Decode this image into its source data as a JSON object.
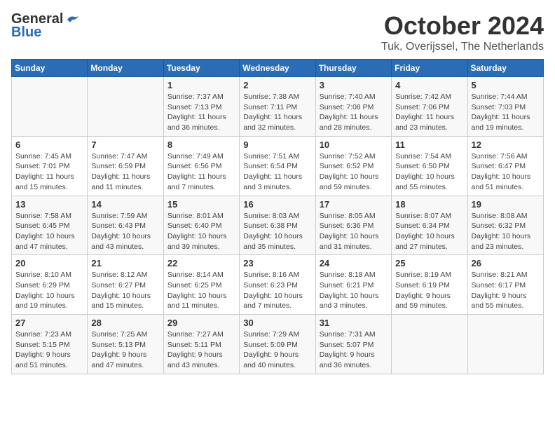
{
  "header": {
    "logo_general": "General",
    "logo_blue": "Blue",
    "month_title": "October 2024",
    "location": "Tuk, Overijssel, The Netherlands"
  },
  "calendar": {
    "headers": [
      "Sunday",
      "Monday",
      "Tuesday",
      "Wednesday",
      "Thursday",
      "Friday",
      "Saturday"
    ],
    "weeks": [
      [
        {
          "day": "",
          "info": ""
        },
        {
          "day": "",
          "info": ""
        },
        {
          "day": "1",
          "info": "Sunrise: 7:37 AM\nSunset: 7:13 PM\nDaylight: 11 hours and 36 minutes."
        },
        {
          "day": "2",
          "info": "Sunrise: 7:38 AM\nSunset: 7:11 PM\nDaylight: 11 hours and 32 minutes."
        },
        {
          "day": "3",
          "info": "Sunrise: 7:40 AM\nSunset: 7:08 PM\nDaylight: 11 hours and 28 minutes."
        },
        {
          "day": "4",
          "info": "Sunrise: 7:42 AM\nSunset: 7:06 PM\nDaylight: 11 hours and 23 minutes."
        },
        {
          "day": "5",
          "info": "Sunrise: 7:44 AM\nSunset: 7:03 PM\nDaylight: 11 hours and 19 minutes."
        }
      ],
      [
        {
          "day": "6",
          "info": "Sunrise: 7:45 AM\nSunset: 7:01 PM\nDaylight: 11 hours and 15 minutes."
        },
        {
          "day": "7",
          "info": "Sunrise: 7:47 AM\nSunset: 6:59 PM\nDaylight: 11 hours and 11 minutes."
        },
        {
          "day": "8",
          "info": "Sunrise: 7:49 AM\nSunset: 6:56 PM\nDaylight: 11 hours and 7 minutes."
        },
        {
          "day": "9",
          "info": "Sunrise: 7:51 AM\nSunset: 6:54 PM\nDaylight: 11 hours and 3 minutes."
        },
        {
          "day": "10",
          "info": "Sunrise: 7:52 AM\nSunset: 6:52 PM\nDaylight: 10 hours and 59 minutes."
        },
        {
          "day": "11",
          "info": "Sunrise: 7:54 AM\nSunset: 6:50 PM\nDaylight: 10 hours and 55 minutes."
        },
        {
          "day": "12",
          "info": "Sunrise: 7:56 AM\nSunset: 6:47 PM\nDaylight: 10 hours and 51 minutes."
        }
      ],
      [
        {
          "day": "13",
          "info": "Sunrise: 7:58 AM\nSunset: 6:45 PM\nDaylight: 10 hours and 47 minutes."
        },
        {
          "day": "14",
          "info": "Sunrise: 7:59 AM\nSunset: 6:43 PM\nDaylight: 10 hours and 43 minutes."
        },
        {
          "day": "15",
          "info": "Sunrise: 8:01 AM\nSunset: 6:40 PM\nDaylight: 10 hours and 39 minutes."
        },
        {
          "day": "16",
          "info": "Sunrise: 8:03 AM\nSunset: 6:38 PM\nDaylight: 10 hours and 35 minutes."
        },
        {
          "day": "17",
          "info": "Sunrise: 8:05 AM\nSunset: 6:36 PM\nDaylight: 10 hours and 31 minutes."
        },
        {
          "day": "18",
          "info": "Sunrise: 8:07 AM\nSunset: 6:34 PM\nDaylight: 10 hours and 27 minutes."
        },
        {
          "day": "19",
          "info": "Sunrise: 8:08 AM\nSunset: 6:32 PM\nDaylight: 10 hours and 23 minutes."
        }
      ],
      [
        {
          "day": "20",
          "info": "Sunrise: 8:10 AM\nSunset: 6:29 PM\nDaylight: 10 hours and 19 minutes."
        },
        {
          "day": "21",
          "info": "Sunrise: 8:12 AM\nSunset: 6:27 PM\nDaylight: 10 hours and 15 minutes."
        },
        {
          "day": "22",
          "info": "Sunrise: 8:14 AM\nSunset: 6:25 PM\nDaylight: 10 hours and 11 minutes."
        },
        {
          "day": "23",
          "info": "Sunrise: 8:16 AM\nSunset: 6:23 PM\nDaylight: 10 hours and 7 minutes."
        },
        {
          "day": "24",
          "info": "Sunrise: 8:18 AM\nSunset: 6:21 PM\nDaylight: 10 hours and 3 minutes."
        },
        {
          "day": "25",
          "info": "Sunrise: 8:19 AM\nSunset: 6:19 PM\nDaylight: 9 hours and 59 minutes."
        },
        {
          "day": "26",
          "info": "Sunrise: 8:21 AM\nSunset: 6:17 PM\nDaylight: 9 hours and 55 minutes."
        }
      ],
      [
        {
          "day": "27",
          "info": "Sunrise: 7:23 AM\nSunset: 5:15 PM\nDaylight: 9 hours and 51 minutes."
        },
        {
          "day": "28",
          "info": "Sunrise: 7:25 AM\nSunset: 5:13 PM\nDaylight: 9 hours and 47 minutes."
        },
        {
          "day": "29",
          "info": "Sunrise: 7:27 AM\nSunset: 5:11 PM\nDaylight: 9 hours and 43 minutes."
        },
        {
          "day": "30",
          "info": "Sunrise: 7:29 AM\nSunset: 5:09 PM\nDaylight: 9 hours and 40 minutes."
        },
        {
          "day": "31",
          "info": "Sunrise: 7:31 AM\nSunset: 5:07 PM\nDaylight: 9 hours and 36 minutes."
        },
        {
          "day": "",
          "info": ""
        },
        {
          "day": "",
          "info": ""
        }
      ]
    ]
  }
}
